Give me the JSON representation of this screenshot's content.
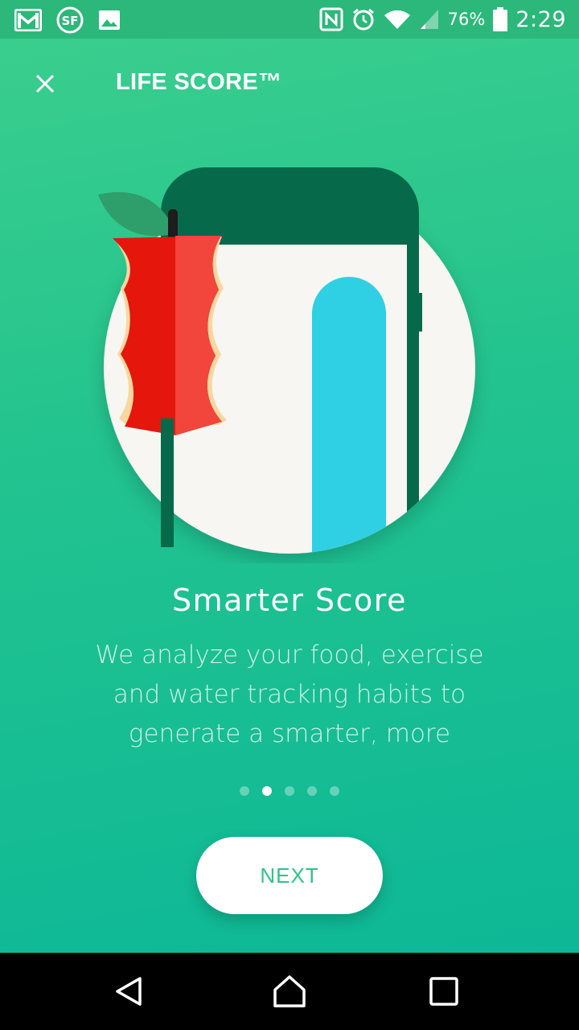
{
  "status_bar": {
    "notification_icons": [
      "gmail-icon",
      "sf-app-icon",
      "image-icon"
    ],
    "system_icons": [
      "nfc-icon",
      "alarm-icon",
      "wifi-icon",
      "signal-icon",
      "battery-icon"
    ],
    "battery_percent": "76%",
    "time": "2:29"
  },
  "toolbar": {
    "close_icon": "close-icon",
    "title": "LIFE SCORE™"
  },
  "onboarding": {
    "headline": "Smarter Score",
    "description": "We analyze your food, exercise and water tracking habits to generate a smarter, more",
    "page_count": 5,
    "current_page": 2
  },
  "actions": {
    "next_label": "NEXT"
  },
  "nav_bar": {
    "back_icon": "back-icon",
    "home_icon": "home-icon",
    "recents_icon": "recents-icon"
  },
  "colors": {
    "background_top": "#3ccf8d",
    "background_bottom": "#0db897",
    "status_bar": "#2cb87a",
    "button_text": "#2fc48a",
    "phone_dark": "#066a4a",
    "water_blue": "#2fd0e3",
    "apple_red": "#e5160c"
  }
}
